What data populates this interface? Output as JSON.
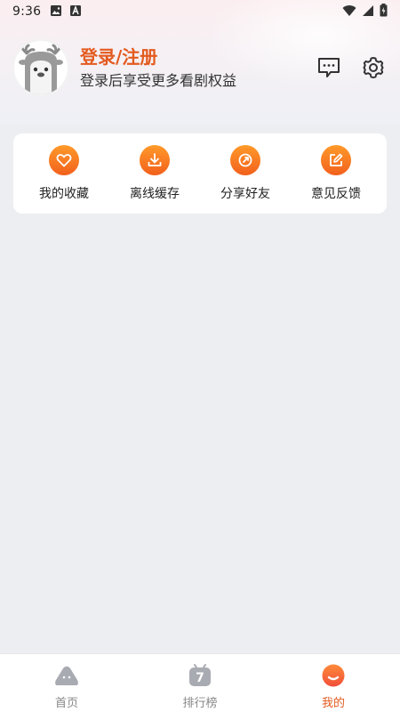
{
  "status_bar": {
    "time": "9:36",
    "left_icons": [
      "image-icon",
      "a-icon"
    ],
    "right_icons": [
      "wifi-icon",
      "signal-icon",
      "battery-charging-icon"
    ]
  },
  "profile": {
    "title": "登录/注册",
    "subtitle": "登录后享受更多看剧权益"
  },
  "top_actions": [
    "message-icon",
    "settings-icon"
  ],
  "quick_actions": [
    {
      "label": "我的收藏",
      "icon": "heart-icon"
    },
    {
      "label": "离线缓存",
      "icon": "download-icon"
    },
    {
      "label": "分享好友",
      "icon": "share-icon"
    },
    {
      "label": "意见反馈",
      "icon": "edit-icon"
    }
  ],
  "bottom_nav": [
    {
      "label": "首页",
      "icon": "home-icon",
      "active": false
    },
    {
      "label": "排行榜",
      "icon": "ranking-icon",
      "badge": "7",
      "active": false
    },
    {
      "label": "我的",
      "icon": "me-icon",
      "active": true
    }
  ],
  "colors": {
    "accent": "#e35a1f",
    "quick_icon_top": "#ff9a2a",
    "quick_icon_bottom": "#f2601c",
    "background": "#eceef2"
  }
}
